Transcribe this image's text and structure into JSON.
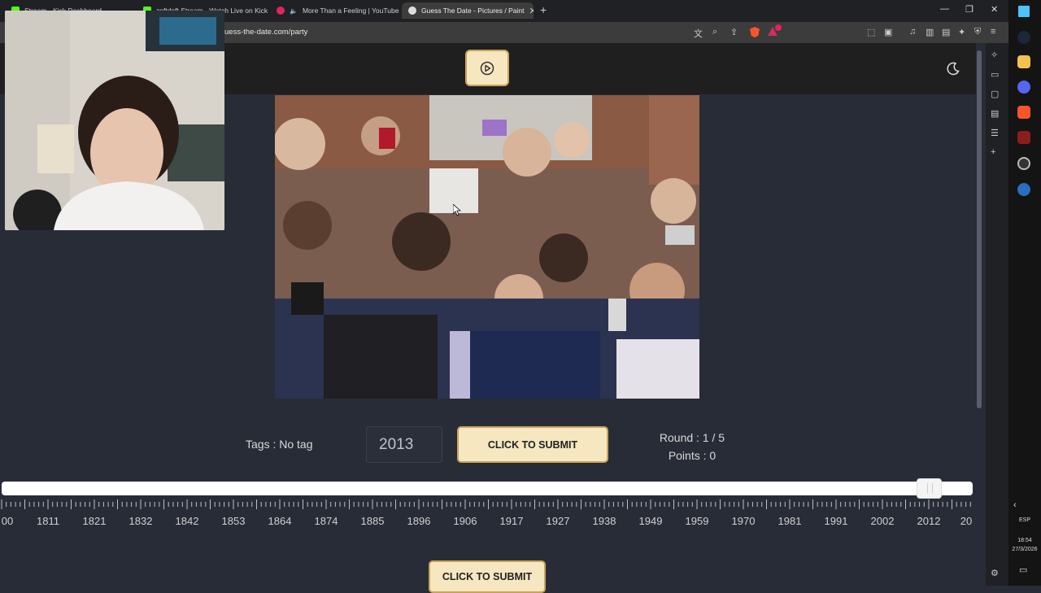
{
  "browser": {
    "tabs": [
      {
        "title": "Stream - Kick Dashboard",
        "color": "#53fc18"
      },
      {
        "title": "zoftdoft Stream - Watch Live on Kick",
        "color": "#53fc18"
      },
      {
        "title": "More Than a Feeling | YouTube M",
        "color": "#e0245e"
      },
      {
        "title": "Guess The Date - Pictures / Paint",
        "color": "#dddddd"
      }
    ],
    "url": "uess-the-date.com/party",
    "close_glyph": "✕",
    "new_tab_glyph": "+",
    "minimize_glyph": "—",
    "restore_glyph": "❐",
    "window_close_glyph": "✕"
  },
  "game": {
    "tags_text": "Tags : No tag",
    "year_value": "2013",
    "submit_label": "CLICK TO SUBMIT",
    "round_text": "Round : 1 / 5",
    "points_text": "Points : 0",
    "bottom_submit_label": "CLICK TO SUBMIT",
    "timeline_labels": [
      "00",
      "1811",
      "1821",
      "1832",
      "1842",
      "1853",
      "1864",
      "1874",
      "1885",
      "1896",
      "1906",
      "1917",
      "1927",
      "1938",
      "1949",
      "1959",
      "1970",
      "1981",
      "1991",
      "2002",
      "2012",
      "20"
    ],
    "slider_year": 2013,
    "accent_color": "#f7e7c0",
    "accent_border": "#c9a35a"
  },
  "taskbar": {
    "lang": "ESP",
    "time": "18:54",
    "date": "27/3/2026"
  }
}
